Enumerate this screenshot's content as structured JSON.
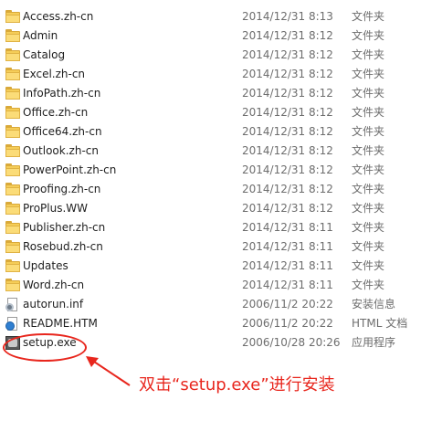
{
  "files": [
    {
      "name": "Access.zh-cn",
      "date": "2014/12/31 8:13",
      "type": "文件夹",
      "icon": "folder-icon"
    },
    {
      "name": "Admin",
      "date": "2014/12/31 8:12",
      "type": "文件夹",
      "icon": "folder-icon"
    },
    {
      "name": "Catalog",
      "date": "2014/12/31 8:12",
      "type": "文件夹",
      "icon": "folder-icon"
    },
    {
      "name": "Excel.zh-cn",
      "date": "2014/12/31 8:12",
      "type": "文件夹",
      "icon": "folder-icon"
    },
    {
      "name": "InfoPath.zh-cn",
      "date": "2014/12/31 8:12",
      "type": "文件夹",
      "icon": "folder-icon"
    },
    {
      "name": "Office.zh-cn",
      "date": "2014/12/31 8:12",
      "type": "文件夹",
      "icon": "folder-icon"
    },
    {
      "name": "Office64.zh-cn",
      "date": "2014/12/31 8:12",
      "type": "文件夹",
      "icon": "folder-icon"
    },
    {
      "name": "Outlook.zh-cn",
      "date": "2014/12/31 8:12",
      "type": "文件夹",
      "icon": "folder-icon"
    },
    {
      "name": "PowerPoint.zh-cn",
      "date": "2014/12/31 8:12",
      "type": "文件夹",
      "icon": "folder-icon"
    },
    {
      "name": "Proofing.zh-cn",
      "date": "2014/12/31 8:12",
      "type": "文件夹",
      "icon": "folder-icon"
    },
    {
      "name": "ProPlus.WW",
      "date": "2014/12/31 8:12",
      "type": "文件夹",
      "icon": "folder-icon"
    },
    {
      "name": "Publisher.zh-cn",
      "date": "2014/12/31 8:11",
      "type": "文件夹",
      "icon": "folder-icon"
    },
    {
      "name": "Rosebud.zh-cn",
      "date": "2014/12/31 8:11",
      "type": "文件夹",
      "icon": "folder-icon"
    },
    {
      "name": "Updates",
      "date": "2014/12/31 8:11",
      "type": "文件夹",
      "icon": "folder-icon"
    },
    {
      "name": "Word.zh-cn",
      "date": "2014/12/31 8:11",
      "type": "文件夹",
      "icon": "folder-icon"
    },
    {
      "name": "autorun.inf",
      "date": "2006/11/2 20:22",
      "type": "安装信息",
      "icon": "settings-file-icon"
    },
    {
      "name": "README.HTM",
      "date": "2006/11/2 20:22",
      "type": "HTML 文档",
      "icon": "html-file-icon"
    },
    {
      "name": "setup.exe",
      "date": "2006/10/28 20:26",
      "type": "应用程序",
      "icon": "setup-exe-icon"
    }
  ],
  "annotation": {
    "text": "双击“setup.exe”进行安装"
  },
  "colors": {
    "annotation": "#e8261d",
    "folder": "#f5cd58",
    "meta_text": "#6d6d6d"
  }
}
